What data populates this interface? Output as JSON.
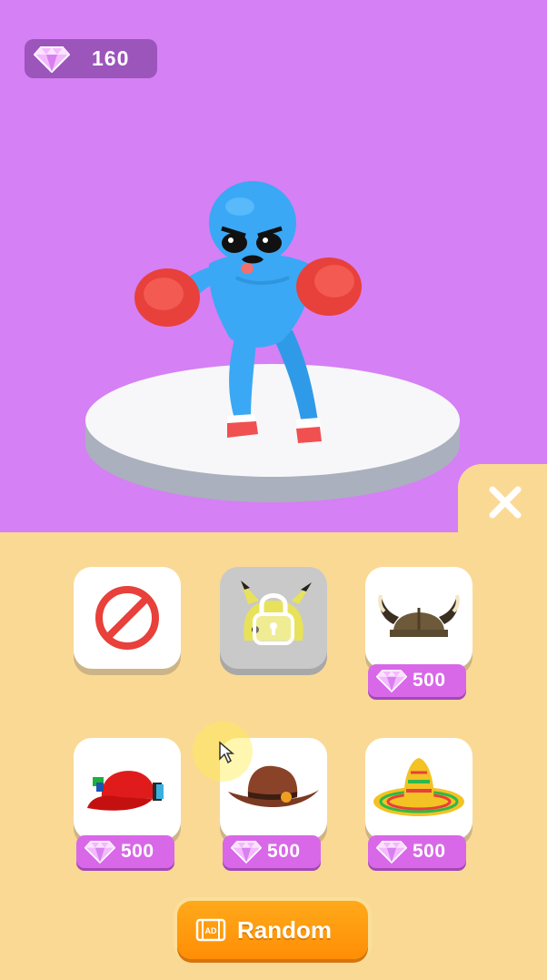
{
  "currency": {
    "icon": "diamond-gem-icon",
    "amount": "160"
  },
  "character": {
    "icon": "blue-boxer-character",
    "skin_color": "#3aa8f5",
    "glove_color": "#e8403a"
  },
  "close_button": {
    "icon": "close-x-icon"
  },
  "hats": [
    {
      "name": "none",
      "icon": "no-hat-icon",
      "state": "available"
    },
    {
      "name": "pikachu",
      "icon": "lock-icon",
      "state": "locked"
    },
    {
      "name": "viking-helmet",
      "icon": "viking-helmet-icon",
      "price": "500"
    },
    {
      "name": "red-cap",
      "icon": "red-cap-icon",
      "price": "500"
    },
    {
      "name": "cowboy-hat",
      "icon": "cowboy-hat-icon",
      "price": "500"
    },
    {
      "name": "sombrero",
      "icon": "sombrero-icon",
      "price": "500"
    }
  ],
  "random_button": {
    "ad_icon": "ad-video-icon",
    "label": "Random"
  },
  "colors": {
    "stage_background": "#d580f4",
    "panel_background": "#fad995",
    "price_tag": "#d868e8",
    "random_button": "#ff9a10"
  }
}
